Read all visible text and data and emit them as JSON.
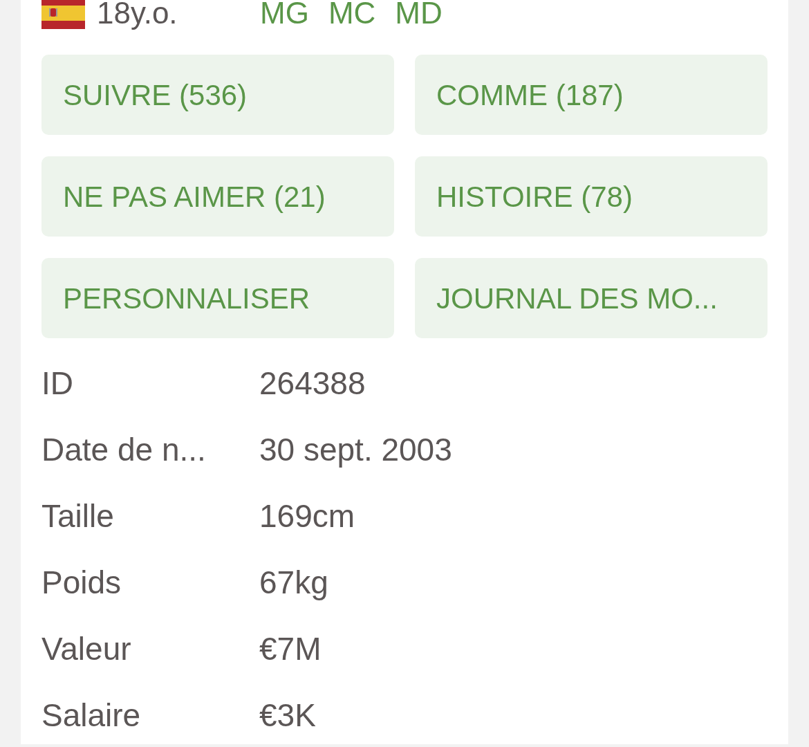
{
  "player": {
    "age": "18y.o.",
    "positions": [
      "MG",
      "MC",
      "MD"
    ]
  },
  "actions": [
    {
      "label": "SUIVRE (536)"
    },
    {
      "label": "COMME (187)"
    },
    {
      "label": "NE PAS AIMER (21)"
    },
    {
      "label": "HISTOIRE (78)"
    },
    {
      "label": "PERSONNALISER"
    },
    {
      "label": "JOURNAL DES MO..."
    }
  ],
  "details": [
    {
      "label": "ID",
      "value": "264388"
    },
    {
      "label": "Date de n...",
      "value": "30 sept. 2003"
    },
    {
      "label": "Taille",
      "value": "169cm"
    },
    {
      "label": "Poids",
      "value": "67kg"
    },
    {
      "label": "Valeur",
      "value": "€7M"
    },
    {
      "label": "Salaire",
      "value": "€3K"
    }
  ]
}
